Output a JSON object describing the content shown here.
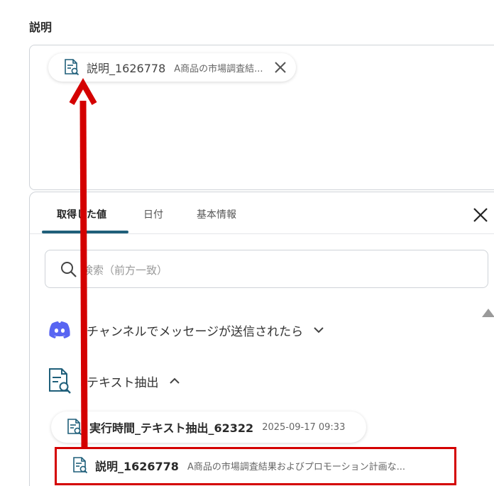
{
  "field": {
    "label": "説明",
    "chip": {
      "name": "説明_1626778",
      "value": "A商品の市場調査結..."
    }
  },
  "panel": {
    "tabs": [
      {
        "label": "取得した値"
      },
      {
        "label": "日付"
      },
      {
        "label": "基本情報"
      }
    ],
    "search_placeholder": "検索（前方一致）",
    "groups": [
      {
        "title": "チャンネルでメッセージが送信されたら",
        "icon": "discord-icon",
        "expanded": false
      },
      {
        "title": "テキスト抽出",
        "icon": "document-search-icon",
        "expanded": true
      }
    ],
    "items": [
      {
        "name": "実行時間_テキスト抽出_62322",
        "value": "2025-09-17 09:33"
      },
      {
        "name": "説明_1626778",
        "value": "A商品の市場調査結果およびプロモーション計画な..."
      }
    ]
  },
  "colors": {
    "accent": "#1f5f7a",
    "annotation": "#d40000",
    "discord": "#5865F2"
  }
}
